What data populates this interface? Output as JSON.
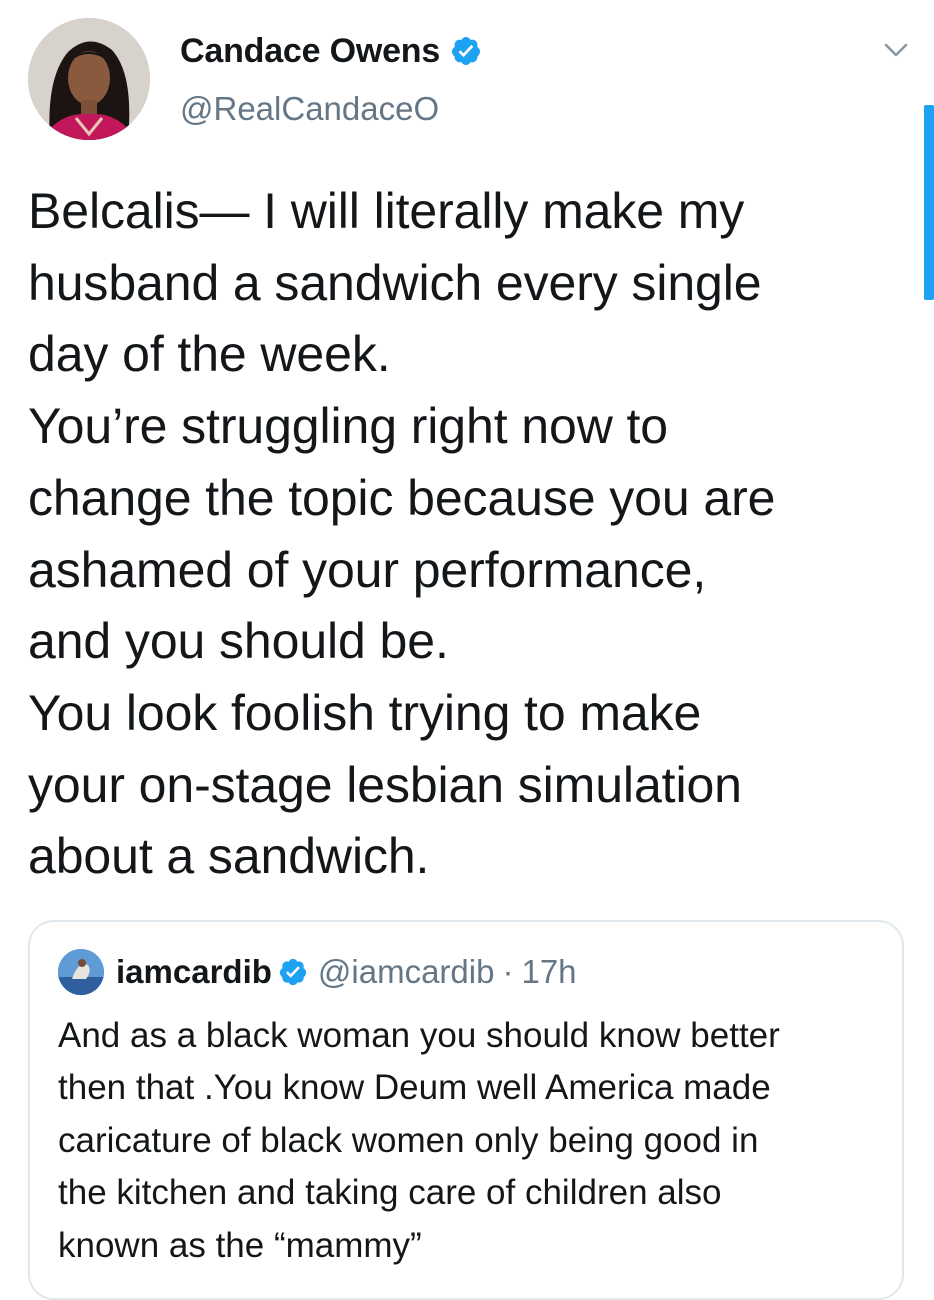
{
  "tweet": {
    "author": {
      "display_name": "Candace Owens",
      "handle": "@RealCandaceO",
      "verified": true
    },
    "text": "Belcalis— I will literally make my\nhusband a sandwich every single\nday of the week.\nYou’re struggling right now to\nchange the topic because you are\nashamed of your performance,\nand you should be.\nYou look foolish trying to make\nyour on-stage lesbian simulation\nabout a sandwich.",
    "menu_icon": "chevron-down-icon"
  },
  "quoted_tweet": {
    "author": {
      "display_name": "iamcardib",
      "handle": "@iamcardib",
      "verified": true
    },
    "separator": "·",
    "time": "17h",
    "text": "And as a black woman you should know better\nthen that .You know Deum well America made\ncaricature of black women only being good in\nthe kitchen and taking care of children also\nknown as the “mammy”"
  },
  "colors": {
    "accent": "#1da1f2",
    "text_primary": "#14171a",
    "text_secondary": "#657786",
    "border": "#e1e8ed"
  }
}
